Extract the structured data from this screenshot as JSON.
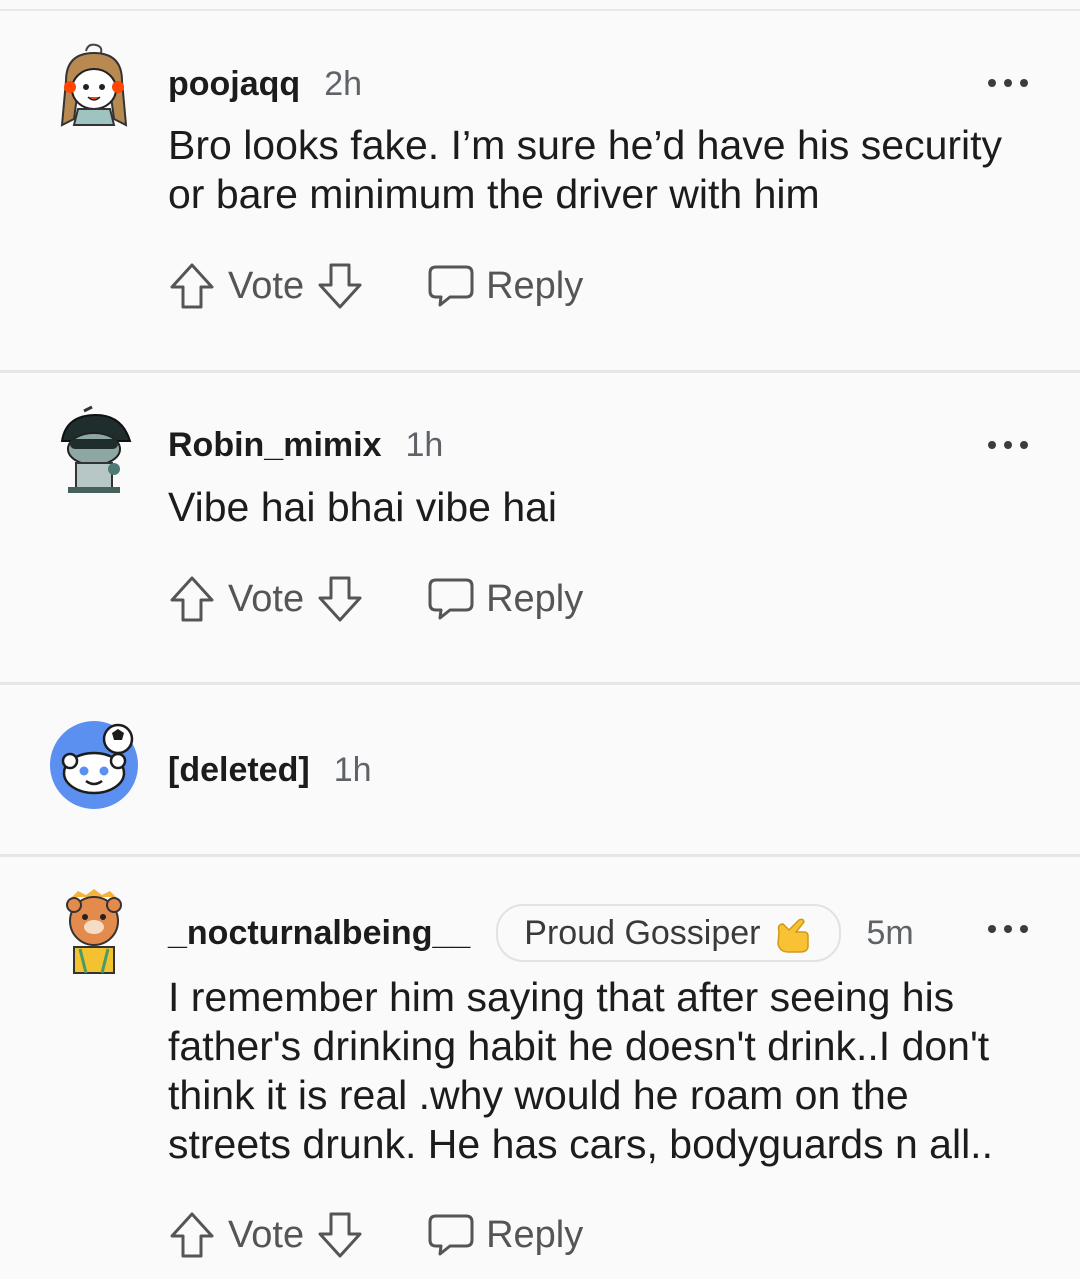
{
  "comments": [
    {
      "username": "poojaqq",
      "time": "2h",
      "text": "Bro looks fake. I’m sure he’d have his security or bare minimum the driver with him",
      "avatar": "anime-girl-avatar-icon",
      "vote_label": "Vote",
      "reply_label": "Reply"
    },
    {
      "username": "Robin_mimix",
      "time": "1h",
      "text": "Vibe hai bhai vibe hai",
      "avatar": "snoo-hat-avatar-icon",
      "vote_label": "Vote",
      "reply_label": "Reply"
    },
    {
      "username": "[deleted]",
      "time": "1h",
      "avatar": "default-snoo-avatar-icon"
    },
    {
      "username": "_nocturnalbeing__",
      "flair": "Proud Gossiper",
      "time": "5m",
      "text": "I remember him saying that after seeing his father's drinking habit he doesn't drink..I don't think it is real .why would he roam on the streets drunk. He has cars, bodyguards n all..",
      "avatar": "bear-avatar-icon",
      "vote_label": "Vote",
      "reply_label": "Reply"
    }
  ],
  "icons": {
    "more": "more-options-icon",
    "upvote": "upvote-arrow-icon",
    "downvote": "downvote-arrow-icon",
    "reply": "reply-bubble-icon",
    "flair_emoji": "call-me-hand-emoji"
  },
  "colors": {
    "background": "#f5f5f5",
    "card": "#fafafa",
    "separator": "#e6e6e6",
    "text": "#1c1c1c",
    "muted": "#5f6368"
  }
}
